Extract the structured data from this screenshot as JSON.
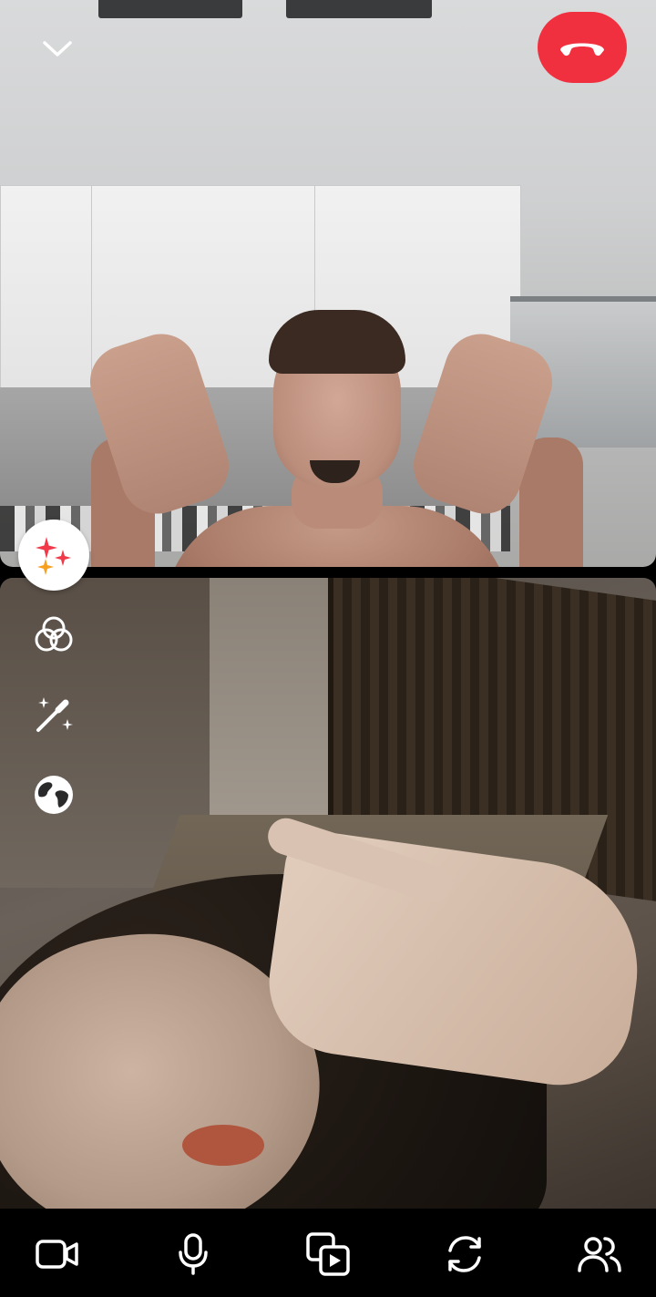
{
  "header": {
    "minimize_icon": "chevron-down-icon",
    "end_call_icon": "phone-hangup-icon",
    "end_call_color": "#f0303f"
  },
  "side_tools": [
    {
      "icon": "sparkles-icon",
      "active": true
    },
    {
      "icon": "filters-circles-icon",
      "active": false
    },
    {
      "icon": "magic-wand-icon",
      "active": false
    },
    {
      "icon": "globe-icon",
      "active": false
    }
  ],
  "bottom_bar": [
    {
      "icon": "video-camera-icon"
    },
    {
      "icon": "microphone-icon"
    },
    {
      "icon": "media-share-icon"
    },
    {
      "icon": "flip-camera-icon"
    },
    {
      "icon": "participants-icon"
    }
  ]
}
